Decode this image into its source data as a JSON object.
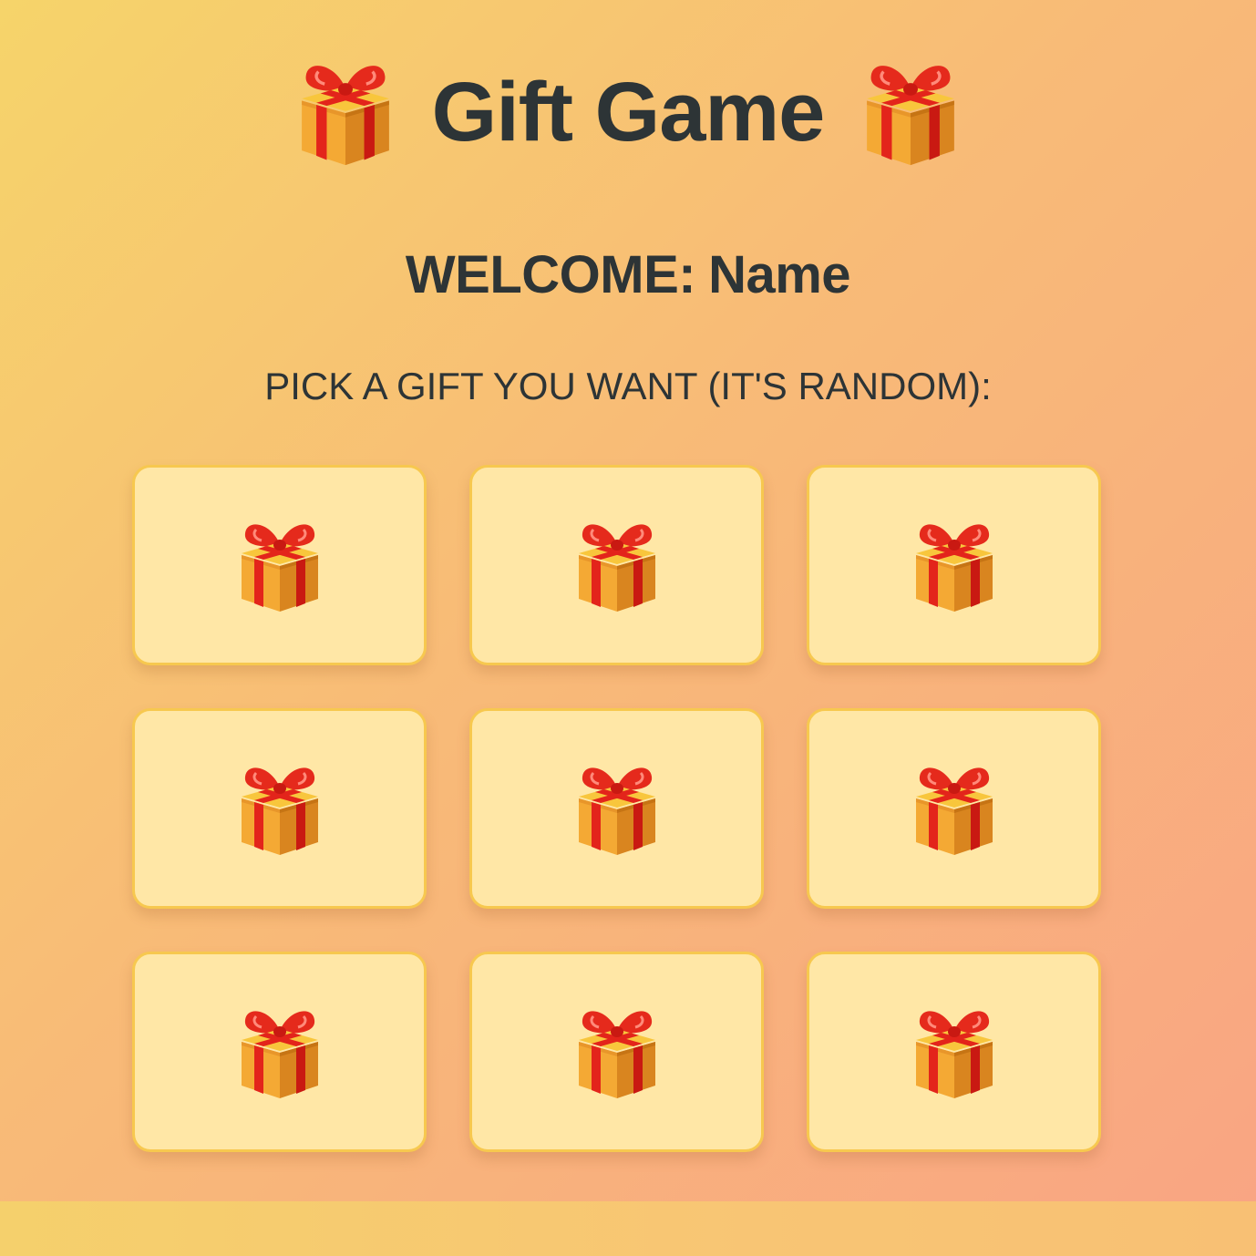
{
  "header": {
    "title": "Gift Game",
    "left_icon": "gift-icon",
    "right_icon": "gift-icon"
  },
  "welcome": {
    "label": "WELCOME:",
    "name": "Name"
  },
  "instruction": "PICK A GIFT YOU WANT (IT'S RANDOM):",
  "gifts": [
    {
      "icon": "gift-icon"
    },
    {
      "icon": "gift-icon"
    },
    {
      "icon": "gift-icon"
    },
    {
      "icon": "gift-icon"
    },
    {
      "icon": "gift-icon"
    },
    {
      "icon": "gift-icon"
    },
    {
      "icon": "gift-icon"
    },
    {
      "icon": "gift-icon"
    },
    {
      "icon": "gift-icon"
    }
  ],
  "colors": {
    "text": "#2d3436",
    "card_bg": "#ffe7a6",
    "card_border": "#f7c84f",
    "gift_box": "#f2a230",
    "gift_ribbon": "#e3241b"
  }
}
